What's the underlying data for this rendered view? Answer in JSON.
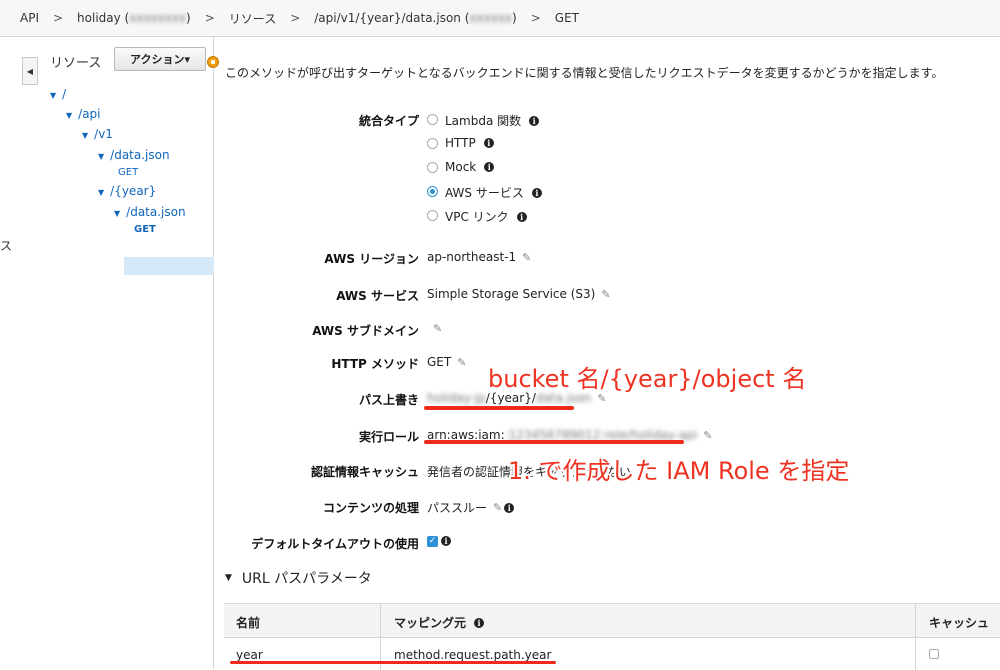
{
  "breadcrumb": {
    "items": [
      "API",
      "holiday (",
      ")",
      "リソース",
      "/api/v1/{year}/data.json (",
      ")",
      "GET"
    ],
    "separator": ">"
  },
  "left_fragment": "ス",
  "resources": {
    "title": "リソース",
    "action_button": "アクション▾",
    "tree": [
      {
        "label": "/"
      },
      {
        "label": "/api"
      },
      {
        "label": "/v1"
      },
      {
        "label": "/data.json"
      },
      {
        "label": "GET"
      },
      {
        "label": "/{year}"
      },
      {
        "label": "/data.json"
      },
      {
        "label": "GET"
      }
    ]
  },
  "description": "このメソッドが呼び出すターゲットとなるバックエンドに関する情報と受信したリクエストデータを変更するかどうかを指定します。",
  "integration": {
    "label": "統合タイプ",
    "options": [
      "Lambda 関数",
      "HTTP",
      "Mock",
      "AWS サービス",
      "VPC リンク"
    ],
    "selected": "AWS サービス"
  },
  "fields": {
    "region": {
      "label": "AWS リージョン",
      "value": "ap-northeast-1"
    },
    "service": {
      "label": "AWS サービス",
      "value": "Simple Storage Service (S3)"
    },
    "subdomain": {
      "label": "AWS サブドメイン",
      "value": ""
    },
    "http_method": {
      "label": "HTTP メソッド",
      "value": "GET"
    },
    "path_override": {
      "label": "パス上書き",
      "value_prefix": "holiday-jp",
      "value_middle": "/{year}/",
      "value_suffix": "data.json"
    },
    "exec_role": {
      "label": "実行ロール",
      "value_prefix": "arn:aws:iam:",
      "value_hidden": ":123456789012:role/holiday-api"
    },
    "credentials_cache": {
      "label": "認証情報キャッシュ",
      "value": "発信者の認証情報をキャッシュしない"
    },
    "content_handling": {
      "label": "コンテンツの処理",
      "value": "パススルー"
    },
    "default_timeout": {
      "label": "デフォルトタイムアウトの使用",
      "checked": true
    }
  },
  "annotations": {
    "bucket": "bucket 名/{year}/object 名",
    "role": "1. で作成した IAM Role を指定"
  },
  "url_params": {
    "title": "URL パスパラメータ",
    "columns": [
      "名前",
      "マッピング元",
      "キャッシュ"
    ],
    "rows": [
      {
        "name": "year",
        "mapping": "method.request.path.year",
        "cache": false
      }
    ]
  },
  "colors": {
    "accent": "#2d8fd5",
    "annotation": "#ee3322",
    "link": "#1166bb",
    "warning_dot": "#f39c12"
  }
}
